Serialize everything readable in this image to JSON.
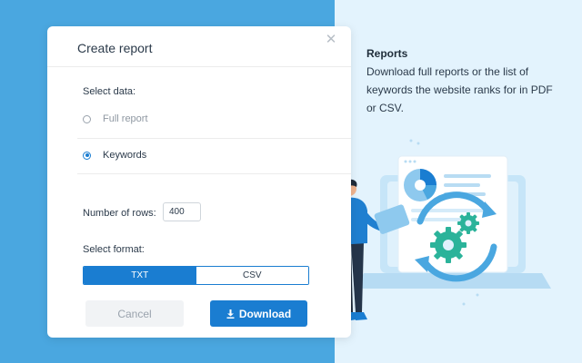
{
  "dialog": {
    "title": "Create report",
    "close_icon": "close-icon",
    "select_data_label": "Select data:",
    "options": [
      {
        "label": "Full report",
        "checked": false
      },
      {
        "label": "Keywords",
        "checked": true
      }
    ],
    "rows_label": "Number of rows:",
    "rows_value": "400",
    "format_label": "Select format:",
    "formats": [
      {
        "label": "TXT",
        "active": true
      },
      {
        "label": "CSV",
        "active": false
      }
    ],
    "cancel_label": "Cancel",
    "download_label": "Download",
    "download_icon": "download-icon"
  },
  "info": {
    "title": "Reports",
    "text": "Download full reports or the list of keywords the website ranks for in PDF or CSV."
  },
  "colors": {
    "left_background": "#4aa7e0",
    "right_background": "#e3f3fd",
    "accent": "#1a7dd1",
    "gear": "#2bb39a"
  }
}
